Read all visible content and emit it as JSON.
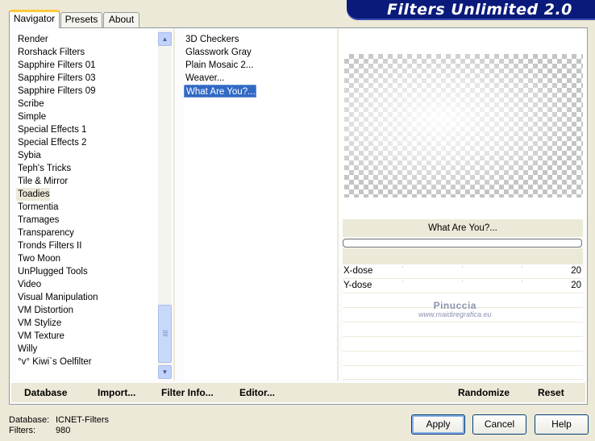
{
  "tabs": [
    {
      "label": "Navigator"
    },
    {
      "label": "Presets"
    },
    {
      "label": "About"
    }
  ],
  "banner": {
    "title": "Filters Unlimited 2.0"
  },
  "categories": [
    "Render",
    "Rorshack Filters",
    "Sapphire Filters 01",
    "Sapphire Filters 03",
    "Sapphire Filters 09",
    "Scribe",
    "Simple",
    "Special Effects 1",
    "Special Effects 2",
    "Sybia",
    "Teph's Tricks",
    "Tile & Mirror",
    "Toadies",
    "Tormentia",
    "Tramages",
    "Transparency",
    "Tronds Filters II",
    "Two Moon",
    "UnPlugged Tools",
    "Video",
    "Visual Manipulation",
    "VM Distortion",
    "VM Stylize",
    "VM Texture",
    "Willy",
    "°v° Kiwi`s Oelfilter"
  ],
  "selected_category": "Toadies",
  "filters": [
    "3D Checkers",
    "Glasswork Gray",
    "Plain Mosaic 2...",
    "Weaver...",
    "What Are You?..."
  ],
  "selected_filter": "What Are You?...",
  "preview": {
    "filter_name": "What Are You?..."
  },
  "params": [
    {
      "name": "X-dose",
      "value": "20"
    },
    {
      "name": "Y-dose",
      "value": "20"
    }
  ],
  "watermark": {
    "line1": "Pinuccia",
    "line2": "www.maidiregrafica.eu"
  },
  "bottom_links": {
    "database": "Database",
    "import": "Import...",
    "filter_info": "Filter Info...",
    "editor": "Editor...",
    "randomize": "Randomize",
    "reset": "Reset"
  },
  "status": {
    "database_label": "Database:",
    "database_value": "ICNET-Filters",
    "filters_label": "Filters:",
    "filters_value": "980"
  },
  "buttons": {
    "apply": "Apply",
    "cancel": "Cancel",
    "help": "Help"
  },
  "colors": {
    "banner": "#0a1a7a",
    "selection": "#316ac5",
    "tab_highlight": "#ffc83c"
  }
}
